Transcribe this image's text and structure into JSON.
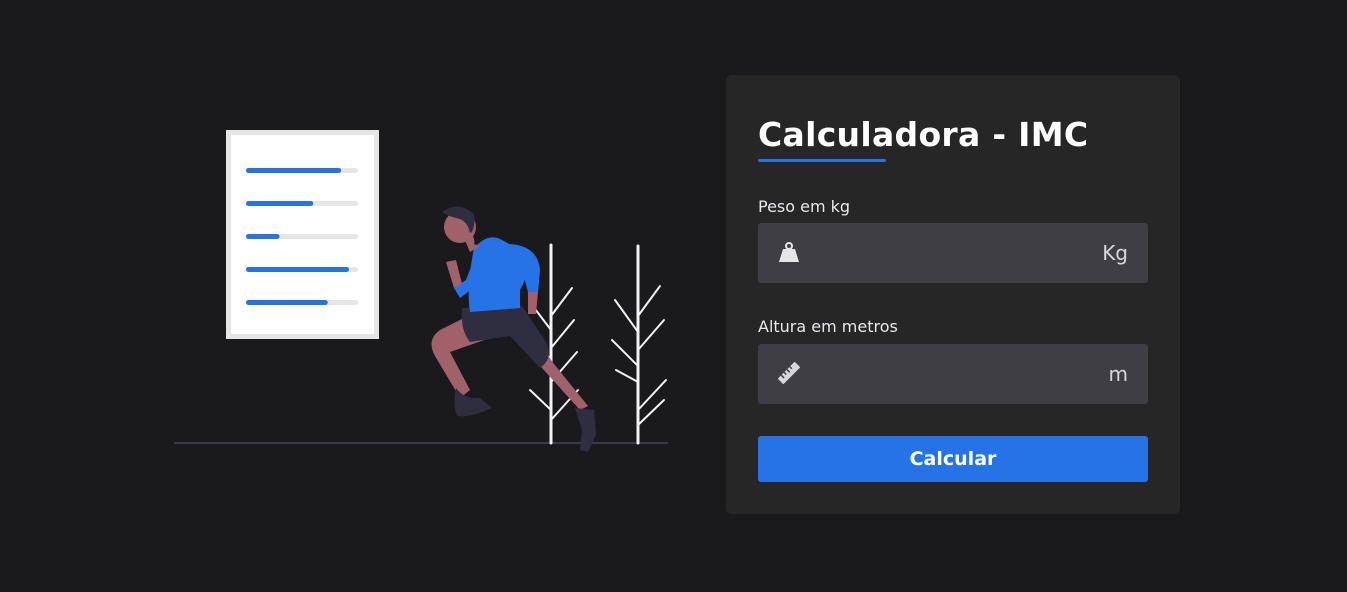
{
  "form": {
    "title": "Calculadora - IMC",
    "weight": {
      "label": "Peso em kg",
      "unit": "Kg",
      "value": "",
      "icon": "weight-icon"
    },
    "height": {
      "label": "Altura em metros",
      "unit": "m",
      "value": "",
      "icon": "ruler-icon"
    },
    "submit_label": "Calcular"
  },
  "illustration": {
    "icon": "runner-illustration",
    "chart_progress": [
      0.85,
      0.6,
      0.3,
      0.92,
      0.73
    ]
  },
  "colors": {
    "background": "#1a1a1c",
    "card": "#262627",
    "input": "#3e3e44",
    "accent": "#2573e6"
  }
}
